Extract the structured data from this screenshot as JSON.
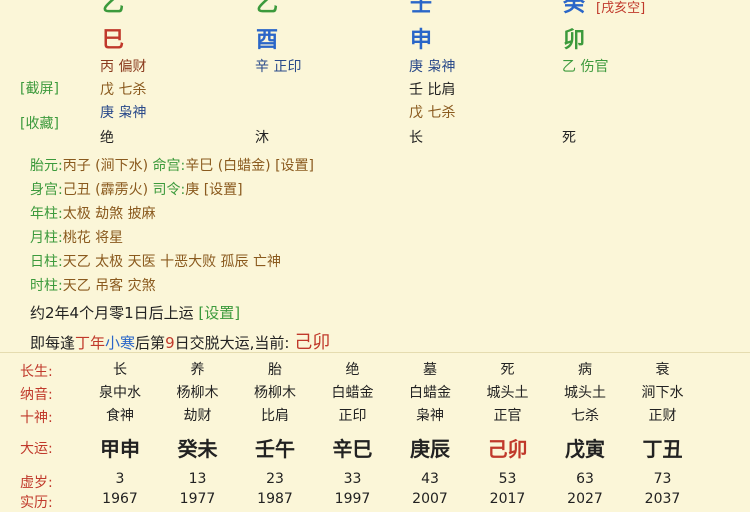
{
  "pillars": {
    "top_stems": [
      {
        "char": "乙",
        "color": "#3c9a3c"
      },
      {
        "char": "乙",
        "color": "#3c9a3c"
      },
      {
        "char": "壬",
        "color": "#2a66c8"
      },
      {
        "char": "癸",
        "color": "#2a66c8"
      }
    ],
    "kongwang": "[戌亥空]",
    "branches": [
      {
        "char": "巳",
        "color": "#c0392b"
      },
      {
        "char": "酉",
        "color": "#2a66c8"
      },
      {
        "char": "申",
        "color": "#2a66c8"
      },
      {
        "char": "卯",
        "color": "#3c9a3c"
      }
    ],
    "hidden_row1": [
      "丙 偏财",
      "辛 正印",
      "庚 枭神",
      "乙 伤官"
    ],
    "hidden_row2": [
      "戊 七杀",
      "",
      "壬 比肩",
      ""
    ],
    "hidden_row3": [
      "庚 枭神",
      "",
      "戊 七杀",
      ""
    ],
    "phase_row": [
      "绝",
      "沐",
      "长",
      "死"
    ]
  },
  "side_links": {
    "screenshot": "[截屏]",
    "favorite": "[收藏]"
  },
  "info": {
    "taiyuan_label": "胎元:",
    "taiyuan_value": "丙子 (涧下水)",
    "minggong_label": "命宫:",
    "minggong_value": "辛巳 (白蜡金)",
    "setting": "[设置]",
    "shengong_label": "身宫:",
    "shengong_value": "己丑 (霹雳火)",
    "siling_label": "司令:",
    "siling_value": "庚",
    "nianzhu_label": "年柱:",
    "nianzhu_value": "太极 劫煞 披麻",
    "yuezhu_label": "月柱:",
    "yuezhu_value": "桃花 将星",
    "rizhu_label": "日柱:",
    "rizhu_value": "天乙 太极 天医 十恶大败 孤辰 亡神",
    "shizhu_label": "时柱:",
    "shizhu_value": "天乙 吊客 灾煞"
  },
  "yun": {
    "line1": "约2年4个月零1日后上运",
    "line2_pre": "即每逢",
    "line2_year": "丁年",
    "line2_term": "小寒",
    "line2_mid": "后第",
    "line2_day": "9",
    "line2_post": "日交脱大运,当前:",
    "current": "己卯"
  },
  "table": {
    "labels": {
      "changsheng": "长生:",
      "nayin": "纳音:",
      "shishen": "十神:",
      "dayun": "大运:",
      "xusui": "虚岁:",
      "shili": "实历:"
    },
    "changsheng": [
      "长",
      "养",
      "胎",
      "绝",
      "墓",
      "死",
      "病",
      "衰"
    ],
    "nayin": [
      "泉中水",
      "杨柳木",
      "杨柳木",
      "白蜡金",
      "白蜡金",
      "城头土",
      "城头土",
      "涧下水"
    ],
    "shishen": [
      "食神",
      "劫财",
      "比肩",
      "正印",
      "枭神",
      "正官",
      "七杀",
      "正财"
    ],
    "dayun": [
      "甲申",
      "癸未",
      "壬午",
      "辛巳",
      "庚辰",
      "己卯",
      "戊寅",
      "丁丑"
    ],
    "xusui": [
      "3",
      "13",
      "23",
      "33",
      "43",
      "53",
      "63",
      "73"
    ],
    "shili": [
      "1967",
      "1977",
      "1987",
      "1997",
      "2007",
      "2017",
      "2027",
      "2037"
    ]
  },
  "colors": {
    "green": "#3c9a3c",
    "red": "#c0392b",
    "blue": "#2a66c8",
    "brown": "#8a5a1e"
  }
}
